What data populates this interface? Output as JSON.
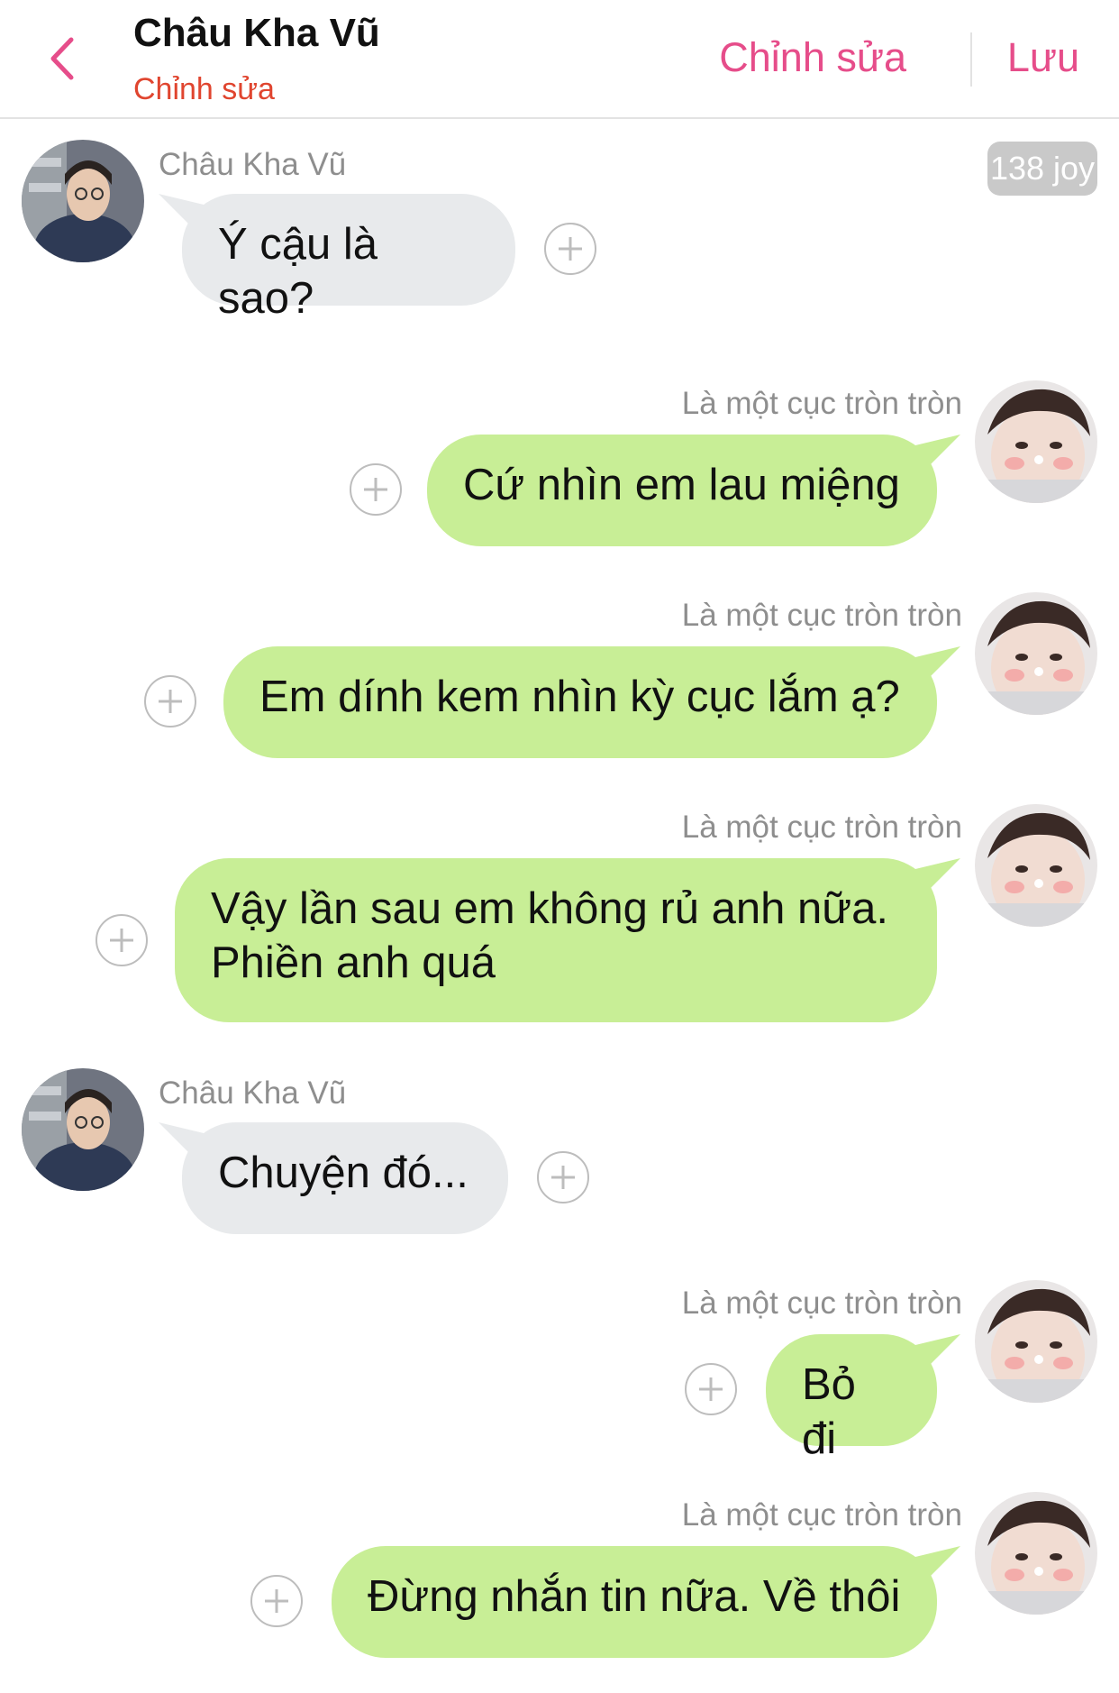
{
  "header": {
    "contact_name": "Châu Kha Vũ",
    "subtitle": "Chỉnh sửa",
    "edit_label": "Chỉnh sửa",
    "save_label": "Lưu"
  },
  "badge": "138 joy",
  "colors": {
    "accent": "#e64d8a",
    "subtitle": "#e0452f",
    "incoming_bubble": "#e8eaec",
    "outgoing_bubble": "#c8ee96"
  },
  "messages": [
    {
      "side": "left",
      "sender": "Châu Kha Vũ",
      "text": "Ý cậu là sao?"
    },
    {
      "side": "right",
      "sender": "Là một cục tròn tròn",
      "text": "Cứ nhìn em lau miệng"
    },
    {
      "side": "right",
      "sender": "Là một cục tròn tròn",
      "text": "Em dính kem nhìn kỳ cục lắm ạ?"
    },
    {
      "side": "right",
      "sender": "Là một cục tròn tròn",
      "text": "Vậy lần sau em không rủ anh nữa.\nPhiền anh quá"
    },
    {
      "side": "left",
      "sender": "Châu Kha Vũ",
      "text": "Chuyện đó..."
    },
    {
      "side": "right",
      "sender": "Là một cục tròn tròn",
      "text": "Bỏ đi"
    },
    {
      "side": "right",
      "sender": "Là một cục tròn tròn",
      "text": "Đừng nhắn tin nữa. Về thôi"
    }
  ]
}
